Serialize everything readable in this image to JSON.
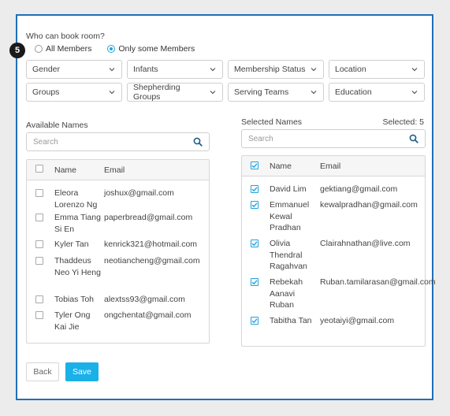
{
  "step_number": "5",
  "question": "Who can book room?",
  "radio_options": [
    {
      "label": "All Members",
      "checked": false
    },
    {
      "label": "Only some Members",
      "checked": true
    }
  ],
  "filters_row1": [
    "Gender",
    "Infants",
    "Membership Status",
    "Location"
  ],
  "filters_row2": [
    "Groups",
    "Shepherding Groups",
    "Serving Teams",
    "Education"
  ],
  "available": {
    "title": "Available Names",
    "search_placeholder": "Search",
    "col_name": "Name",
    "col_email": "Email",
    "rows": [
      {
        "name": "Eleora Lorenzo Ng",
        "email": "joshux@gmail.com"
      },
      {
        "name": "Emma Tiang Si En",
        "email": "paperbread@gmail.com"
      },
      {
        "name": "Kyler Tan",
        "email": "kenrick321@hotmail.com"
      },
      {
        "name": "Thaddeus Neo Yi Heng",
        "email": "neotiancheng@gmail.com"
      },
      {
        "name": "Tobias Toh",
        "email": "alextss93@gmail.com"
      },
      {
        "name": "Tyler Ong Kai Jie",
        "email": "ongchentat@gmail.com"
      }
    ]
  },
  "selected": {
    "title": "Selected Names",
    "count": "Selected: 5",
    "search_placeholder": "Search",
    "col_name": "Name",
    "col_email": "Email",
    "rows": [
      {
        "name": "David Lim",
        "email": "gektiang@gmail.com"
      },
      {
        "name": "Emmanuel Kewal Pradhan",
        "email": "kewalpradhan@gmail.com"
      },
      {
        "name": "Olivia Thendral Ragahvan",
        "email": "Clairahnathan@live.com"
      },
      {
        "name": "Rebekah Aanavi Ruban",
        "email": "Ruban.tamilarasan@gmail.com"
      },
      {
        "name": "Tabitha Tan",
        "email": "yeotaiyi@gmail.com"
      }
    ]
  },
  "buttons": {
    "back": "Back",
    "save": "Save"
  },
  "colors": {
    "accent": "#1ab0e8",
    "frame": "#1f6fb8"
  }
}
